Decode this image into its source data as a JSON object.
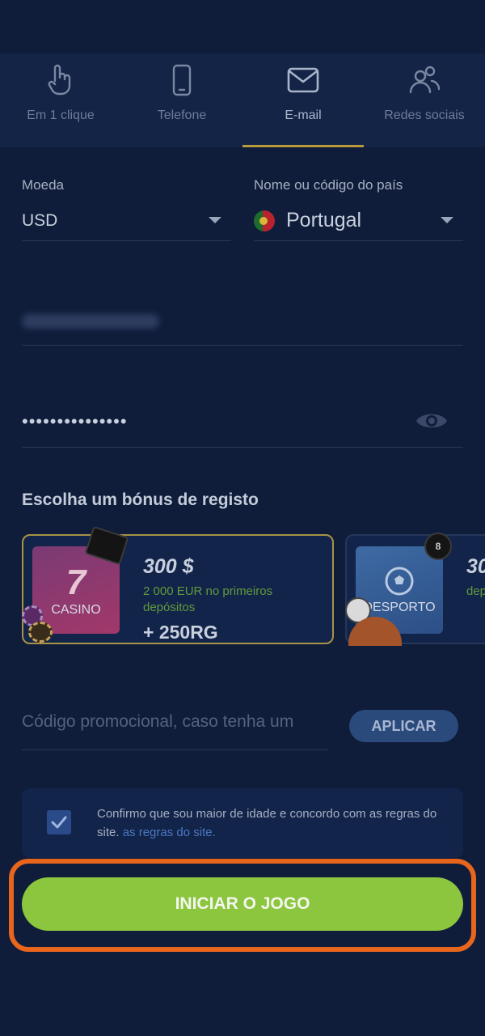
{
  "tabs": [
    {
      "label": "Em 1 clique",
      "icon": "tap-finger-icon"
    },
    {
      "label": "Telefone",
      "icon": "phone-icon"
    },
    {
      "label": "E-mail",
      "icon": "envelope-icon",
      "active": true
    },
    {
      "label": "Redes sociais",
      "icon": "people-icon"
    }
  ],
  "currency": {
    "label": "Moeda",
    "value": "USD"
  },
  "country": {
    "label": "Nome ou código do país",
    "value": "Portugal"
  },
  "password": {
    "value": "•••••••••••••••"
  },
  "bonus": {
    "title": "Escolha um bónus de registo",
    "cards": [
      {
        "category": "CASINO",
        "amount": "300 $",
        "desc": "2 000 EUR no primeiros depósitos",
        "extra": "+ 250RG",
        "selected": true
      },
      {
        "category": "DESPORTO",
        "amount": "30",
        "desc": "dep"
      }
    ]
  },
  "promo": {
    "placeholder": "Código promocional, caso tenha um",
    "apply_label": "APLICAR"
  },
  "consent": {
    "text": "Confirmo que sou maior de idade e concordo com as regras do site.",
    "link": "as regras do site."
  },
  "start_label": "INICIAR O JOGO",
  "colors": {
    "accent": "#8cc63f",
    "highlight": "#e8651c",
    "tab_indicator": "#b89a3a"
  }
}
